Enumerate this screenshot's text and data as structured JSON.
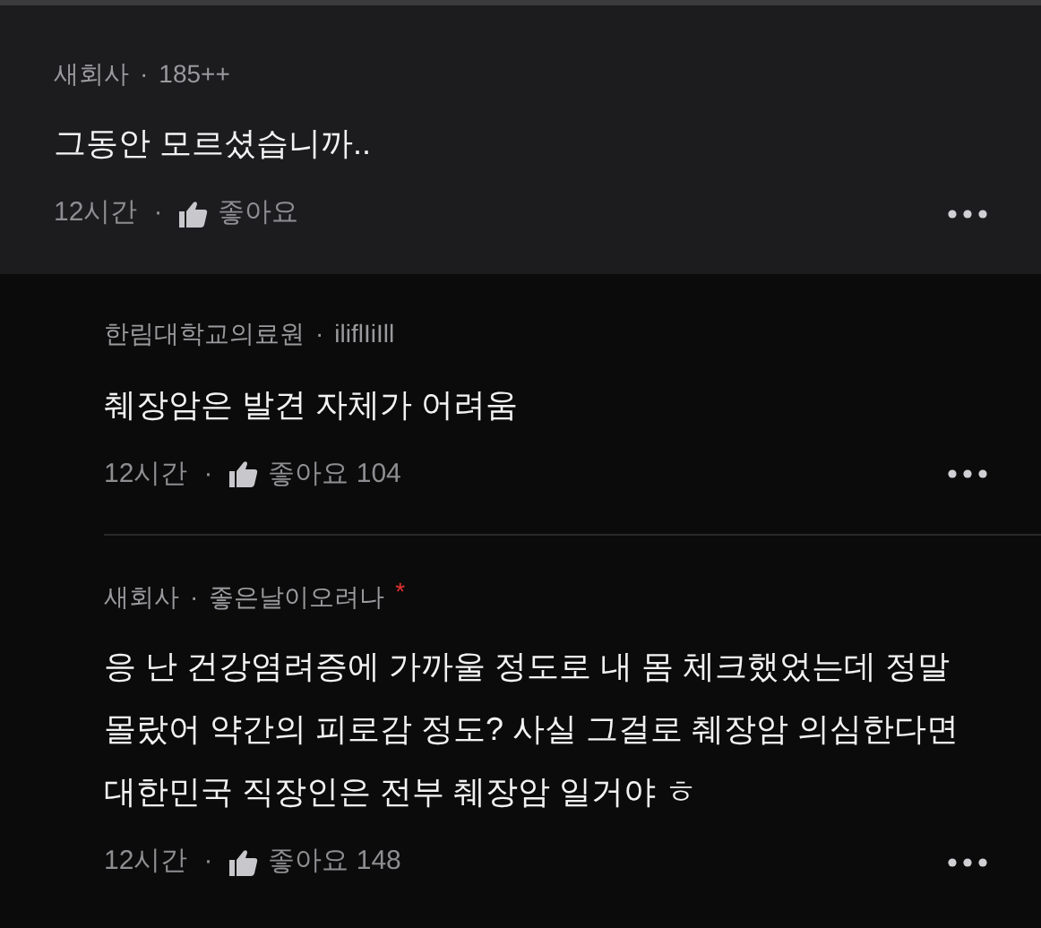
{
  "comments": [
    {
      "kind": "top",
      "highlighted": true,
      "author": "새회사",
      "meta_separator": "·",
      "handle": "185++",
      "text": "그동안 모르셨습니까..",
      "time": "12시간",
      "footer_separator": "·",
      "like_label": "좋아요"
    },
    {
      "kind": "reply",
      "highlighted": false,
      "author": "한림대학교의료원",
      "meta_separator": "·",
      "handle": "iliflIiIll",
      "text": "췌장암은 발견 자체가 어려움",
      "time": "12시간",
      "footer_separator": "·",
      "like_label": "좋아요",
      "like_count": "104"
    },
    {
      "kind": "reply",
      "highlighted": false,
      "author": "새회사",
      "meta_separator": "·",
      "handle": "좋은날이오려나",
      "author_mark": "*",
      "text": "응 난 건강염려증에 가까울 정도로 내 몸 체크했었는데 정말 몰랐어 약간의 피로감 정도? 사실 그걸로 췌장암 의심한다면 대한민국 직장인은 전부 췌장암 일거야 ㅎ",
      "time": "12시간",
      "footer_separator": "·",
      "like_label": "좋아요",
      "like_count": "148"
    }
  ]
}
